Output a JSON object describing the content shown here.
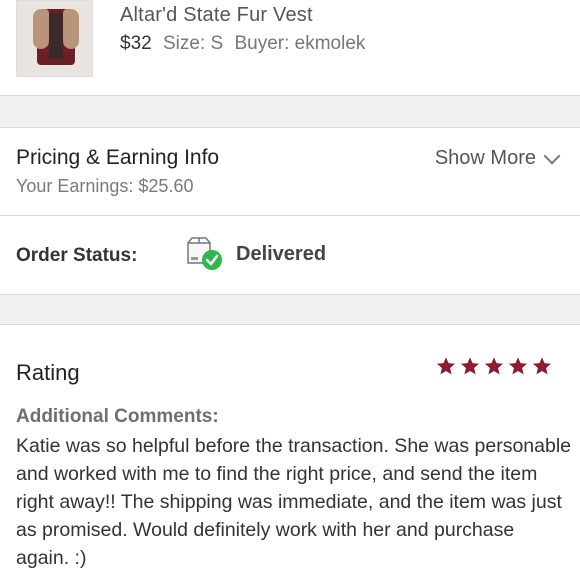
{
  "item": {
    "title": "Altar'd State Fur Vest",
    "price": "$32",
    "size": "Size: S",
    "buyer": "Buyer: ekmolek"
  },
  "pricing": {
    "title": "Pricing & Earning Info",
    "earnings": "Your Earnings: $25.60",
    "show_more": "Show More"
  },
  "order": {
    "label": "Order Status:",
    "status": "Delivered",
    "status_icon": "package-delivered-icon",
    "status_color": "#2eb84b"
  },
  "rating": {
    "title": "Rating",
    "stars": 5,
    "max_stars": 5,
    "star_color": "#8b1c2c",
    "comments_label": "Additional Comments:",
    "comments": "Katie was so helpful before the transaction. She was personable and worked with me to find the right price, and send the item right away!! The shipping was immediate, and the item was just as promised. Would definitely work with her and purchase again. :)"
  }
}
